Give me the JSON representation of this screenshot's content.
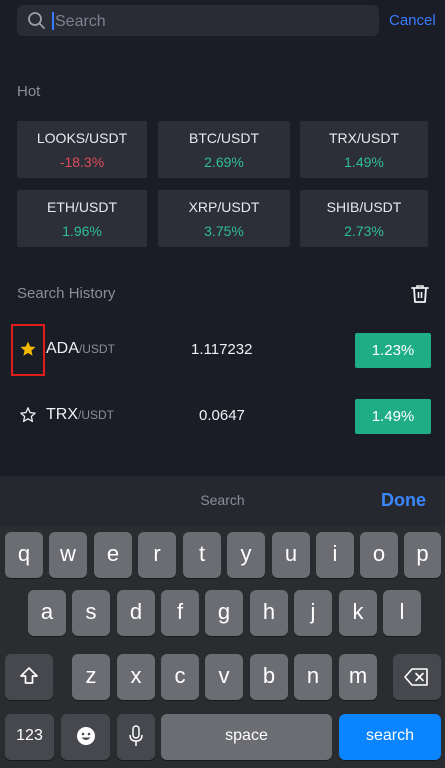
{
  "search": {
    "placeholder": "Search",
    "value": "",
    "cancel_label": "Cancel"
  },
  "hot": {
    "title": "Hot",
    "items": [
      {
        "pair": "LOOKS/USDT",
        "change": "-18.3%",
        "trend": "down"
      },
      {
        "pair": "BTC/USDT",
        "change": "2.69%",
        "trend": "up"
      },
      {
        "pair": "TRX/USDT",
        "change": "1.49%",
        "trend": "up"
      },
      {
        "pair": "ETH/USDT",
        "change": "1.96%",
        "trend": "up"
      },
      {
        "pair": "XRP/USDT",
        "change": "3.75%",
        "trend": "up"
      },
      {
        "pair": "SHIB/USDT",
        "change": "2.73%",
        "trend": "up"
      }
    ]
  },
  "history": {
    "title": "Search History",
    "items": [
      {
        "symbol": "ADA",
        "quote": "/USDT",
        "price": "1.117232",
        "change": "1.23%",
        "favorited": true
      },
      {
        "symbol": "TRX",
        "quote": "/USDT",
        "price": "0.0647",
        "change": "1.49%",
        "favorited": false
      }
    ]
  },
  "keyboard": {
    "bar_label": "Search",
    "done_label": "Done",
    "row1": [
      "q",
      "w",
      "e",
      "r",
      "t",
      "y",
      "u",
      "i",
      "o",
      "p"
    ],
    "row2": [
      "a",
      "s",
      "d",
      "f",
      "g",
      "h",
      "j",
      "k",
      "l"
    ],
    "row3": [
      "z",
      "x",
      "c",
      "v",
      "b",
      "n",
      "m"
    ],
    "numbers_label": "123",
    "space_label": "space",
    "search_label": "search"
  },
  "colors": {
    "accent": "#3a7bff",
    "positive": "#2fbf94",
    "negative": "#e04a5c",
    "badge": "#1fad85"
  }
}
